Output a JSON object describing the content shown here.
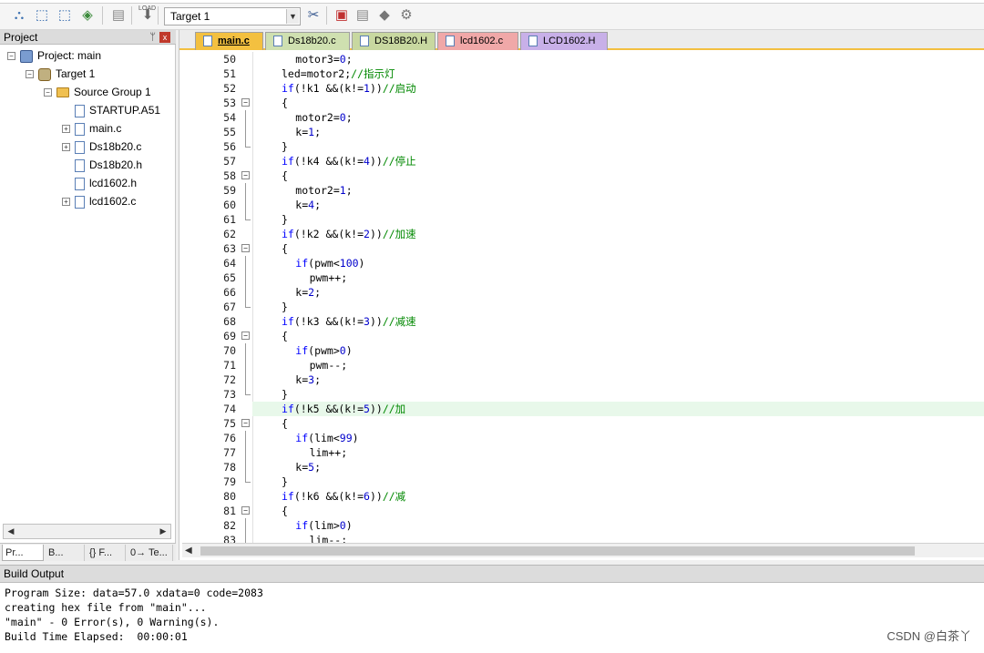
{
  "toolbar": {
    "target_value": "Target 1",
    "load_label": "LOAD",
    "icons": [
      "translate-icon",
      "build-icon",
      "rebuild-icon",
      "batch-build-icon",
      "stop-build-icon",
      "download-icon",
      "options-icon",
      "manage-components-icon",
      "select-packs-icon",
      "pack-installer-icon",
      "manage-rte-icon"
    ]
  },
  "project": {
    "title": "Project",
    "pin": "ᛘ",
    "close": "x",
    "tree": [
      {
        "label": "Project: main",
        "expander": "-"
      },
      {
        "label": "Target 1",
        "expander": "-"
      },
      {
        "label": "Source Group 1",
        "expander": "-"
      },
      {
        "label": "STARTUP.A51",
        "expander": ""
      },
      {
        "label": "main.c",
        "expander": "+"
      },
      {
        "label": "Ds18b20.c",
        "expander": "+"
      },
      {
        "label": "Ds18b20.h",
        "expander": ""
      },
      {
        "label": "lcd1602.h",
        "expander": ""
      },
      {
        "label": "lcd1602.c",
        "expander": "+"
      }
    ],
    "bottom_tabs": [
      "Pr...",
      "B...",
      "{} F...",
      "0→ Te..."
    ]
  },
  "editor": {
    "tabs": [
      {
        "label": "main.c",
        "color": "#f3c040"
      },
      {
        "label": "Ds18b20.c",
        "color": "#cfe0b0"
      },
      {
        "label": "DS18B20.H",
        "color": "#c8d8a0"
      },
      {
        "label": "lcd1602.c",
        "color": "#f0a8a8"
      },
      {
        "label": "LCD1602.H",
        "color": "#c8b0e8"
      }
    ],
    "lines": [
      {
        "n": "50",
        "indent": 8,
        "fold": "",
        "segs": [
          [
            "t",
            "motor3="
          ],
          [
            "n",
            "0"
          ],
          [
            "t",
            ";"
          ]
        ]
      },
      {
        "n": "51",
        "indent": 6,
        "fold": "",
        "segs": [
          [
            "t",
            "led=motor2;"
          ],
          [
            "c",
            "//指示灯"
          ]
        ]
      },
      {
        "n": "52",
        "indent": 6,
        "fold": "",
        "segs": [
          [
            "k",
            "if"
          ],
          [
            "t",
            "(!k1 &&(k!="
          ],
          [
            "n",
            "1"
          ],
          [
            "t",
            "))"
          ],
          [
            "c",
            "//启动"
          ]
        ]
      },
      {
        "n": "53",
        "indent": 6,
        "fold": "-",
        "segs": [
          [
            "t",
            "{"
          ]
        ]
      },
      {
        "n": "54",
        "indent": 8,
        "fold": "|",
        "segs": [
          [
            "t",
            "motor2="
          ],
          [
            "n",
            "0"
          ],
          [
            "t",
            ";"
          ]
        ]
      },
      {
        "n": "55",
        "indent": 8,
        "fold": "|",
        "segs": [
          [
            "t",
            "k="
          ],
          [
            "n",
            "1"
          ],
          [
            "t",
            ";"
          ]
        ]
      },
      {
        "n": "56",
        "indent": 6,
        "fold": "e",
        "segs": [
          [
            "t",
            "}"
          ]
        ]
      },
      {
        "n": "57",
        "indent": 6,
        "fold": "",
        "segs": [
          [
            "k",
            "if"
          ],
          [
            "t",
            "(!k4 &&(k!="
          ],
          [
            "n",
            "4"
          ],
          [
            "t",
            "))"
          ],
          [
            "c",
            "//停止"
          ]
        ]
      },
      {
        "n": "58",
        "indent": 6,
        "fold": "-",
        "segs": [
          [
            "t",
            "{"
          ]
        ]
      },
      {
        "n": "59",
        "indent": 8,
        "fold": "|",
        "segs": [
          [
            "t",
            "motor2="
          ],
          [
            "n",
            "1"
          ],
          [
            "t",
            ";"
          ]
        ]
      },
      {
        "n": "60",
        "indent": 8,
        "fold": "|",
        "segs": [
          [
            "t",
            "k="
          ],
          [
            "n",
            "4"
          ],
          [
            "t",
            ";"
          ]
        ]
      },
      {
        "n": "61",
        "indent": 6,
        "fold": "e",
        "segs": [
          [
            "t",
            "}"
          ]
        ]
      },
      {
        "n": "62",
        "indent": 6,
        "fold": "",
        "segs": [
          [
            "k",
            "if"
          ],
          [
            "t",
            "(!k2 &&(k!="
          ],
          [
            "n",
            "2"
          ],
          [
            "t",
            "))"
          ],
          [
            "c",
            "//加速"
          ]
        ]
      },
      {
        "n": "63",
        "indent": 6,
        "fold": "-",
        "segs": [
          [
            "t",
            "{"
          ]
        ]
      },
      {
        "n": "64",
        "indent": 8,
        "fold": "|",
        "segs": [
          [
            "k",
            "if"
          ],
          [
            "t",
            "(pwm<"
          ],
          [
            "n",
            "100"
          ],
          [
            "t",
            ")"
          ]
        ]
      },
      {
        "n": "65",
        "indent": 10,
        "fold": "|",
        "segs": [
          [
            "t",
            "pwm++;"
          ]
        ]
      },
      {
        "n": "66",
        "indent": 8,
        "fold": "|",
        "segs": [
          [
            "t",
            "k="
          ],
          [
            "n",
            "2"
          ],
          [
            "t",
            ";"
          ]
        ]
      },
      {
        "n": "67",
        "indent": 6,
        "fold": "e",
        "segs": [
          [
            "t",
            "}"
          ]
        ]
      },
      {
        "n": "68",
        "indent": 6,
        "fold": "",
        "segs": [
          [
            "k",
            "if"
          ],
          [
            "t",
            "(!k3 &&(k!="
          ],
          [
            "n",
            "3"
          ],
          [
            "t",
            "))"
          ],
          [
            "c",
            "//减速"
          ]
        ]
      },
      {
        "n": "69",
        "indent": 6,
        "fold": "-",
        "segs": [
          [
            "t",
            "{"
          ]
        ]
      },
      {
        "n": "70",
        "indent": 8,
        "fold": "|",
        "segs": [
          [
            "k",
            "if"
          ],
          [
            "t",
            "(pwm>"
          ],
          [
            "n",
            "0"
          ],
          [
            "t",
            ")"
          ]
        ]
      },
      {
        "n": "71",
        "indent": 10,
        "fold": "|",
        "segs": [
          [
            "t",
            "pwm--;"
          ]
        ]
      },
      {
        "n": "72",
        "indent": 8,
        "fold": "|",
        "segs": [
          [
            "t",
            "k="
          ],
          [
            "n",
            "3"
          ],
          [
            "t",
            ";"
          ]
        ]
      },
      {
        "n": "73",
        "indent": 6,
        "fold": "e",
        "segs": [
          [
            "t",
            "}"
          ]
        ]
      },
      {
        "n": "74",
        "indent": 6,
        "fold": "",
        "hl": true,
        "segs": [
          [
            "k",
            "if"
          ],
          [
            "t",
            "(!k5 &&(k!="
          ],
          [
            "n",
            "5"
          ],
          [
            "t",
            "))"
          ],
          [
            "c",
            "//加"
          ]
        ]
      },
      {
        "n": "75",
        "indent": 6,
        "fold": "-",
        "segs": [
          [
            "t",
            "{"
          ]
        ]
      },
      {
        "n": "76",
        "indent": 8,
        "fold": "|",
        "segs": [
          [
            "k",
            "if"
          ],
          [
            "t",
            "(lim<"
          ],
          [
            "n",
            "99"
          ],
          [
            "t",
            ")"
          ]
        ]
      },
      {
        "n": "77",
        "indent": 10,
        "fold": "|",
        "segs": [
          [
            "t",
            "lim++;"
          ]
        ]
      },
      {
        "n": "78",
        "indent": 8,
        "fold": "|",
        "segs": [
          [
            "t",
            "k="
          ],
          [
            "n",
            "5"
          ],
          [
            "t",
            ";"
          ]
        ]
      },
      {
        "n": "79",
        "indent": 6,
        "fold": "e",
        "segs": [
          [
            "t",
            "}"
          ]
        ]
      },
      {
        "n": "80",
        "indent": 6,
        "fold": "",
        "segs": [
          [
            "k",
            "if"
          ],
          [
            "t",
            "(!k6 &&(k!="
          ],
          [
            "n",
            "6"
          ],
          [
            "t",
            "))"
          ],
          [
            "c",
            "//减"
          ]
        ]
      },
      {
        "n": "81",
        "indent": 6,
        "fold": "-",
        "segs": [
          [
            "t",
            "{"
          ]
        ]
      },
      {
        "n": "82",
        "indent": 8,
        "fold": "|",
        "segs": [
          [
            "k",
            "if"
          ],
          [
            "t",
            "(lim>"
          ],
          [
            "n",
            "0"
          ],
          [
            "t",
            ")"
          ]
        ]
      },
      {
        "n": "83",
        "indent": 10,
        "fold": "|",
        "segs": [
          [
            "t",
            "lim--;"
          ]
        ]
      }
    ]
  },
  "build": {
    "title": "Build Output",
    "lines": [
      "Program Size: data=57.0 xdata=0 code=2083",
      "creating hex file from \"main\"...",
      "\"main\" - 0 Error(s), 0 Warning(s).",
      "Build Time Elapsed:  00:00:01"
    ]
  },
  "watermark": "CSDN @白茶丫"
}
